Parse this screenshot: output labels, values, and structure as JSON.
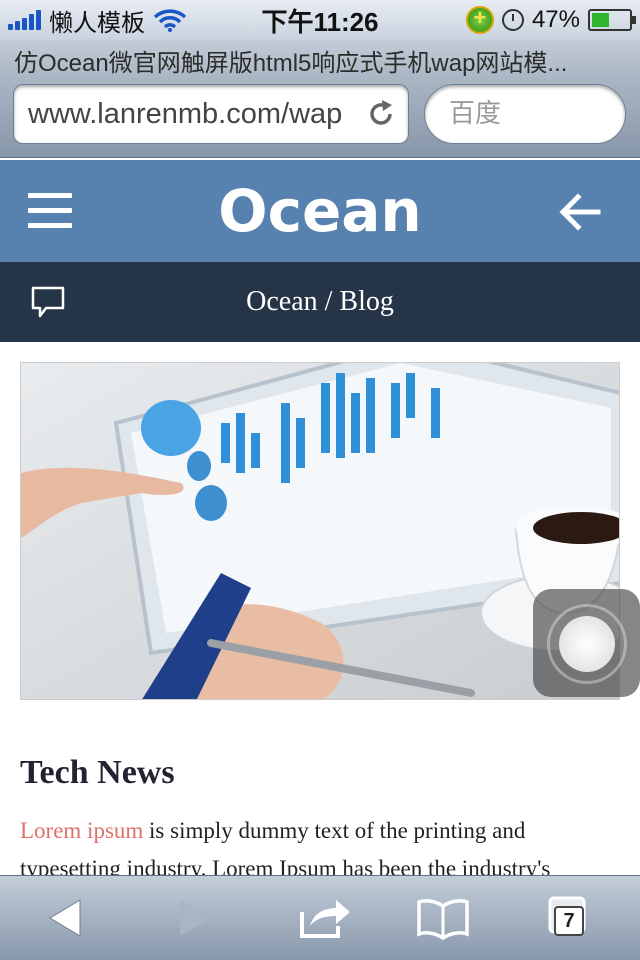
{
  "status_bar": {
    "carrier": "懒人模板",
    "time": "下午11:26",
    "battery": "47%",
    "battery_level": 0.47
  },
  "browser": {
    "page_title": "仿Ocean微官网触屏版html5响应式手机wap网站模...",
    "url": "www.lanrenmb.com/wap",
    "search_placeholder": "百度",
    "tab_count": "7"
  },
  "site": {
    "logo": "Ocean",
    "breadcrumb": "Ocean / Blog",
    "header_color": "#5782b0",
    "subheader_color": "#253446"
  },
  "article": {
    "title": "Tech News",
    "lead": "Lorem ipsum",
    "body": " is simply dummy text of the printing and typesetting industry. Lorem Ipsum has been the industry's",
    "lead_color": "#e0706a"
  },
  "icons": {
    "menu": "hamburger-icon",
    "back": "arrow-left-icon",
    "comment": "speech-bubble-icon",
    "reload": "reload-icon",
    "browser_back": "triangle-left-icon",
    "browser_forward": "triangle-right-icon",
    "share": "share-icon",
    "bookmarks": "open-book-icon",
    "tabs": "tabs-icon"
  }
}
